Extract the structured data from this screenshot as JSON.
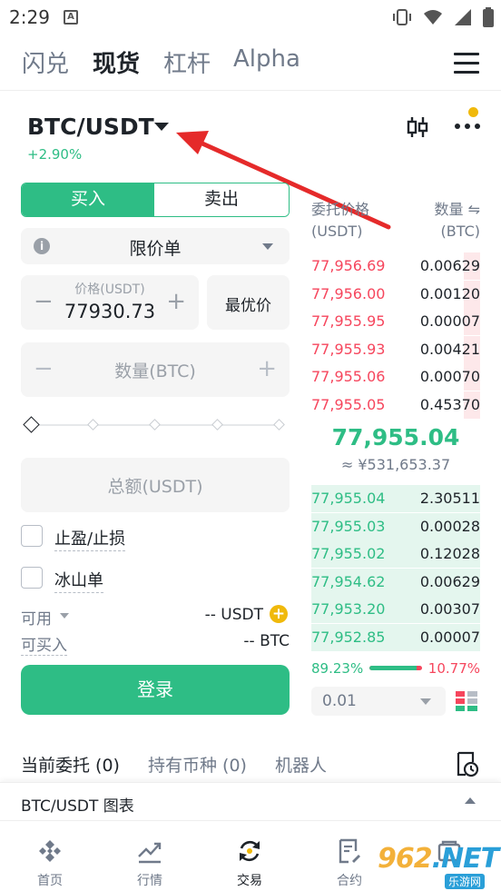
{
  "status_bar": {
    "time": "2:29",
    "a_badge": "A"
  },
  "top_nav": {
    "tabs": [
      "闪兑",
      "现货",
      "杠杆",
      "Alpha"
    ],
    "active": "现货"
  },
  "pair": {
    "symbol": "BTC/USDT",
    "change": "+2.90%"
  },
  "form": {
    "buy_label": "买入",
    "sell_label": "卖出",
    "order_type": "限价单",
    "price_placeholder": "价格(USDT)",
    "price_value": "77930.73",
    "best_price_label": "最优价",
    "qty_placeholder": "数量(BTC)",
    "minus": "−",
    "plus": "+",
    "slider_value": 0,
    "total_placeholder": "总额(USDT)",
    "tp_sl_label": "止盈/止损",
    "iceberg_label": "冰山单",
    "available_label": "可用",
    "available_value": "-- USDT",
    "buyable_label": "可买入",
    "buyable_value": "-- BTC",
    "login_label": "登录"
  },
  "order_book": {
    "price_header_1": "委托价格",
    "price_header_2": "(USDT)",
    "qty_header_1": "数量 ⇋",
    "qty_header_2": "(BTC)",
    "asks": [
      {
        "price": "77,956.69",
        "qty": "0.00629",
        "depth": 0.1
      },
      {
        "price": "77,956.00",
        "qty": "0.00120",
        "depth": 0.1
      },
      {
        "price": "77,955.95",
        "qty": "0.00007",
        "depth": 0.1
      },
      {
        "price": "77,955.93",
        "qty": "0.00421",
        "depth": 0.1
      },
      {
        "price": "77,955.06",
        "qty": "0.00070",
        "depth": 0.1
      },
      {
        "price": "77,955.05",
        "qty": "0.45370",
        "depth": 0.1
      }
    ],
    "last_price": "77,955.04",
    "last_fiat": "≈ ¥531,653.37",
    "bids": [
      {
        "price": "77,955.04",
        "qty": "2.30511",
        "depth": 1.0
      },
      {
        "price": "77,955.03",
        "qty": "0.00028",
        "depth": 1.0
      },
      {
        "price": "77,955.02",
        "qty": "0.12028",
        "depth": 1.0
      },
      {
        "price": "77,954.62",
        "qty": "0.00629",
        "depth": 1.0
      },
      {
        "price": "77,953.20",
        "qty": "0.00307",
        "depth": 1.0
      },
      {
        "price": "77,952.85",
        "qty": "0.00007",
        "depth": 1.0
      }
    ],
    "buy_ratio": "89.23%",
    "sell_ratio": "10.77%",
    "buy_ratio_value": 0.8923,
    "precision": "0.01"
  },
  "orders_tabs": {
    "open_orders": "当前委托 (0)",
    "holdings": "持有币种 (0)",
    "bots": "机器人"
  },
  "chart_bar": {
    "label": "BTC/USDT 图表"
  },
  "bottom_nav": {
    "home": "首页",
    "markets": "行情",
    "trade": "交易",
    "futures": "合约",
    "assets": ""
  },
  "watermark": {
    "logo_a": "962",
    "logo_b": ".NET",
    "sub": "乐游网"
  },
  "colors": {
    "green": "#2ebd85",
    "red": "#f6465d",
    "yellow": "#f0b90b",
    "text": "#1e2329",
    "muted": "#707a8a"
  }
}
